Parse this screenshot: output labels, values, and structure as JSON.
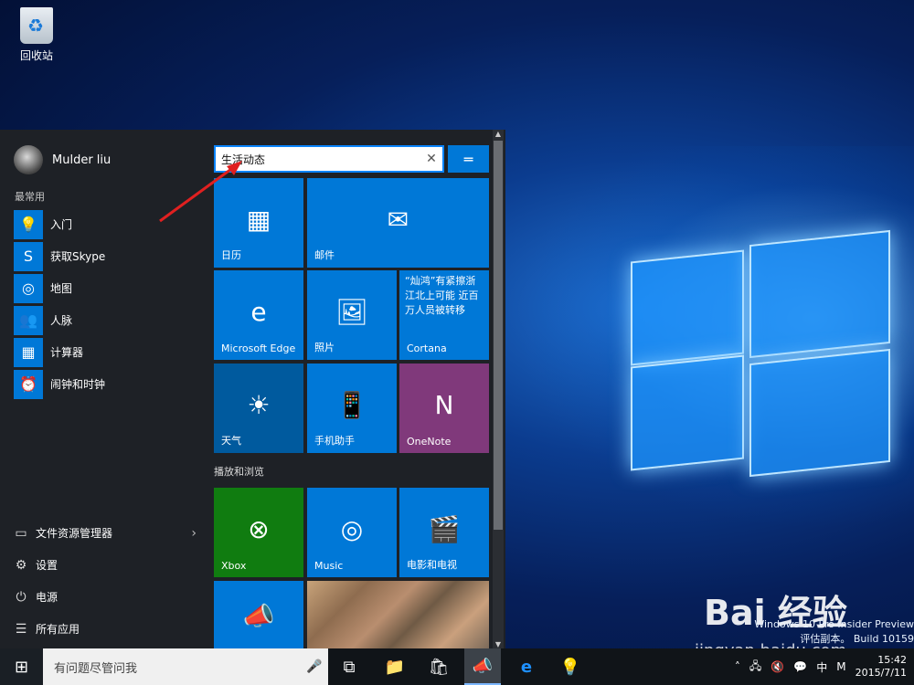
{
  "desktop": {
    "recycle_bin_label": "回收站"
  },
  "start_menu": {
    "user_name": "Mulder liu",
    "most_used_label": "最常用",
    "apps": [
      {
        "label": "入门",
        "icon": "lightbulb-icon"
      },
      {
        "label": "获取Skype",
        "icon": "skype-icon"
      },
      {
        "label": "地图",
        "icon": "map-icon"
      },
      {
        "label": "人脉",
        "icon": "people-icon"
      },
      {
        "label": "计算器",
        "icon": "calculator-icon"
      },
      {
        "label": "闹钟和时钟",
        "icon": "alarm-icon"
      }
    ],
    "bottom_items": [
      {
        "label": "文件资源管理器",
        "icon": "folder-icon"
      },
      {
        "label": "设置",
        "icon": "gear-icon"
      },
      {
        "label": "电源",
        "icon": "power-icon"
      },
      {
        "label": "所有应用",
        "icon": "list-icon"
      }
    ],
    "search_value": "生活动态",
    "tiles": [
      {
        "label": "日历",
        "icon": "calendar-icon"
      },
      {
        "label": "邮件",
        "icon": "mail-icon"
      },
      {
        "label": "Microsoft Edge",
        "icon": "edge-icon"
      },
      {
        "label": "照片",
        "icon": "photo-icon"
      },
      {
        "label": "Cortana",
        "news": "“灿鸿”有紧擦浙江北上可能 近百万人员被转移"
      },
      {
        "label": "天气",
        "icon": "sun-icon"
      },
      {
        "label": "手机助手",
        "icon": "phone-icon"
      },
      {
        "label": "OneNote",
        "icon": "onenote-icon"
      }
    ],
    "group2_label": "播放和浏览",
    "tiles2": [
      {
        "label": "Xbox",
        "icon": "xbox-icon"
      },
      {
        "label": "Music",
        "icon": "music-icon"
      },
      {
        "label": "电影和电视",
        "icon": "film-icon"
      }
    ]
  },
  "taskbar": {
    "search_placeholder": "有问题尽管问我",
    "ime": "中",
    "keyboard": "M",
    "time": "15:42",
    "date": "2015/7/11"
  },
  "watermark": {
    "line1": "Windows 10 Pro Insider Preview",
    "line2": "评估副本。 Build 10159"
  },
  "baidu": {
    "logo": "Bai 经验",
    "url": "jingyan.baidu.com"
  },
  "colors": {
    "tile_blue": "#0078d7",
    "tile_green": "#107c10",
    "tile_purple": "#80397b",
    "tile_dark_blue": "#005a9e"
  }
}
